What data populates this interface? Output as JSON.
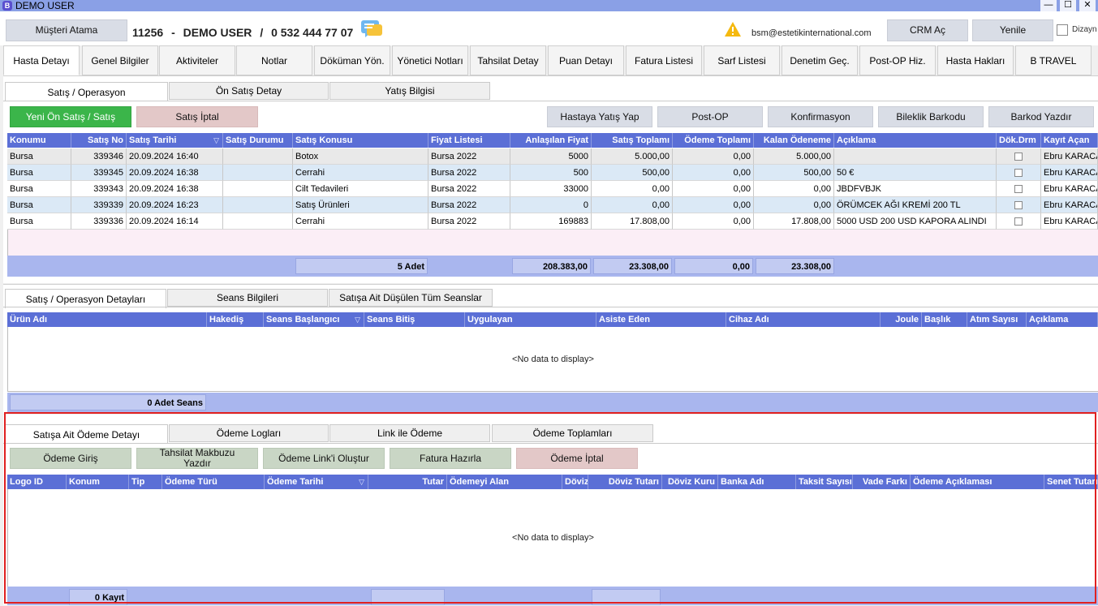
{
  "window": {
    "title": "DEMO USER",
    "app_letter": "B",
    "minimize": "—",
    "maximize": "☐",
    "close": "✕"
  },
  "topbar": {
    "assign_button": "Müşteri Atama",
    "patient_id": "11256",
    "sep1": "-",
    "patient_name": "DEMO USER",
    "sep2": "/",
    "phone": "0 532 444 77 07",
    "email": "bsm@estetikinternational.com",
    "crm_button": "CRM Aç",
    "refresh_button": "Yenile",
    "design_label": "Dizayn"
  },
  "main_tabs": [
    "Hasta Detayı",
    "Genel Bilgiler",
    "Aktiviteler",
    "Notlar",
    "Döküman Yön.",
    "Yönetici Notları",
    "Tahsilat Detay",
    "Puan Detayı",
    "Fatura Listesi",
    "Sarf Listesi",
    "Denetim Geç.",
    "Post-OP Hiz.",
    "Hasta Hakları",
    "B TRAVEL"
  ],
  "section1": {
    "tabs": [
      "Satış / Operasyon",
      "Ön Satış Detay",
      "Yatış Bilgisi"
    ],
    "buttons_left": [
      "Yeni Ön Satış / Satış",
      "Satış İptal"
    ],
    "buttons_right": [
      "Hastaya Yatış Yap",
      "Post-OP",
      "Konfirmasyon",
      "Bileklik Barkodu",
      "Barkod Yazdır"
    ],
    "columns": [
      "Konumu",
      "Satış No",
      "Satış Tarihi",
      "Satış Durumu",
      "Satış Konusu",
      "Fiyat Listesi",
      "Anlaşılan Fiyat",
      "Satış Toplamı",
      "Ödeme Toplamı",
      "Kalan Ödeneme",
      "Açıklama",
      "Dök.Drm",
      "Kayıt Açan"
    ],
    "rows": [
      [
        "Bursa",
        "339346",
        "20.09.2024 16:40",
        "",
        "Botox",
        "Bursa 2022",
        "5000",
        "5.000,00",
        "0,00",
        "5.000,00",
        "",
        "",
        "Ebru KARACA"
      ],
      [
        "Bursa",
        "339345",
        "20.09.2024 16:38",
        "",
        "Cerrahi",
        "Bursa 2022",
        "500",
        "500,00",
        "0,00",
        "500,00",
        "50 €",
        "",
        "Ebru KARACA"
      ],
      [
        "Bursa",
        "339343",
        "20.09.2024 16:38",
        "",
        "Cilt Tedavileri",
        "Bursa 2022",
        "33000",
        "0,00",
        "0,00",
        "0,00",
        "JBDFVBJK",
        "",
        "Ebru KARACA"
      ],
      [
        "Bursa",
        "339339",
        "20.09.2024 16:23",
        "",
        "Satış Ürünleri",
        "Bursa 2022",
        "0",
        "0,00",
        "0,00",
        "0,00",
        "ÖRÜMCEK AĞI KREMİ 200 TL",
        "",
        "Ebru KARACA"
      ],
      [
        "Bursa",
        "339336",
        "20.09.2024 16:14",
        "",
        "Cerrahi",
        "Bursa 2022",
        "169883",
        "17.808,00",
        "0,00",
        "17.808,00",
        "5000 USD 200 USD KAPORA ALINDI",
        "",
        "Ebru KARACA"
      ]
    ],
    "footer": {
      "count": "5 Adet",
      "agreed": "208.383,00",
      "sales_total": "23.308,00",
      "payment_total": "0,00",
      "remaining": "23.308,00"
    }
  },
  "section2": {
    "tabs": [
      "Satış / Operasyon Detayları",
      "Seans Bilgileri",
      "Satışa Ait Düşülen Tüm Seanslar"
    ],
    "columns": [
      "Ürün Adı",
      "Hakediş",
      "Seans Başlangıcı",
      "Seans Bitiş",
      "Uygulayan",
      "Asiste Eden",
      "Cihaz Adı",
      "Joule",
      "Başlık",
      "Atım Sayısı",
      "Açıklama"
    ],
    "no_data": "<No data to display>",
    "footer_count": "0 Adet Seans"
  },
  "section3": {
    "tabs": [
      "Satışa Ait Ödeme Detayı",
      "Ödeme Logları",
      "Link ile Ödeme",
      "Ödeme Toplamları"
    ],
    "buttons": [
      "Ödeme Giriş",
      "Tahsilat Makbuzu Yazdır",
      "Ödeme Link'i Oluştur",
      "Fatura Hazırla",
      "Ödeme İptal"
    ],
    "columns": [
      "Logo ID",
      "Konum",
      "Tip",
      "Ödeme Türü",
      "Ödeme Tarihi",
      "Tutar",
      "Ödemeyi Alan",
      "Döviz",
      "Döviz Tutarı",
      "Döviz Kuru",
      "Banka Adı",
      "Taksit Sayısı",
      "Vade Farkı",
      "Ödeme Açıklaması",
      "Senet Tutarı"
    ],
    "no_data": "<No data to display>",
    "footer_count": "0 Kayıt"
  },
  "colors": {
    "header_blue": "#5b6fd6",
    "highlight_red": "#e02020",
    "green_button": "#3bb54a"
  }
}
